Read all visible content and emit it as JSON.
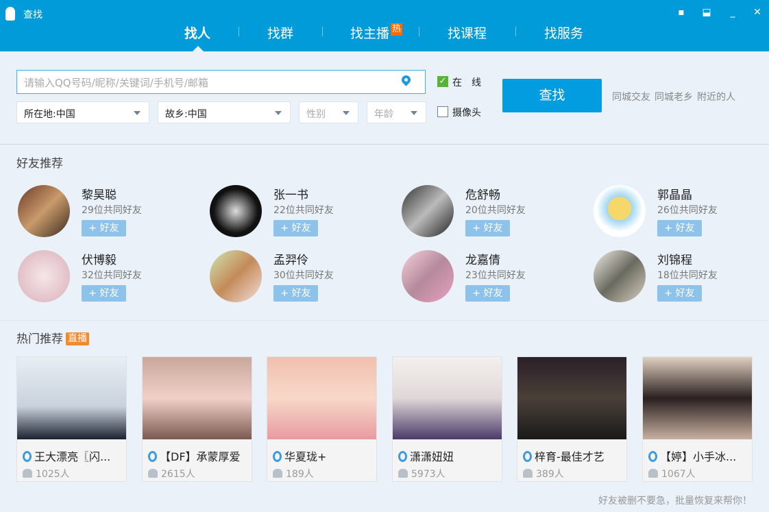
{
  "window": {
    "title": "查找",
    "controls": [
      "feedback-icon",
      "skin-icon",
      "minimize-icon",
      "close-icon"
    ]
  },
  "tabs": [
    {
      "label": "找人",
      "active": true
    },
    {
      "label": "找群"
    },
    {
      "label": "找主播",
      "badge": "热"
    },
    {
      "label": "找课程"
    },
    {
      "label": "找服务"
    }
  ],
  "search": {
    "placeholder": "请输入QQ号码/昵称/关键词/手机号/邮箱",
    "value": "",
    "button": "查找"
  },
  "filters": {
    "location": "所在地:中国",
    "hometown": "故乡:中国",
    "gender": "性别",
    "age": "年龄"
  },
  "checks": {
    "online": {
      "label": "在　线",
      "checked": true
    },
    "camera": {
      "label": "摄像头",
      "checked": false
    }
  },
  "quick_links": [
    "同城交友",
    "同城老乡",
    "附近的人"
  ],
  "friends": {
    "title": "好友推荐",
    "add_label": "+ 好友",
    "items": [
      {
        "name": "黎昊聪",
        "mutual": "29位共同好友"
      },
      {
        "name": "张一书",
        "mutual": "22位共同好友"
      },
      {
        "name": "危舒畅",
        "mutual": "20位共同好友"
      },
      {
        "name": "郭晶晶",
        "mutual": "26位共同好友"
      },
      {
        "name": "伏博毅",
        "mutual": "32位共同好友"
      },
      {
        "name": "孟羿伶",
        "mutual": "30位共同好友"
      },
      {
        "name": "龙嘉倩",
        "mutual": "23位共同好友"
      },
      {
        "name": "刘锦程",
        "mutual": "18位共同好友"
      }
    ]
  },
  "hot": {
    "title": "热门推荐",
    "badge": "直播",
    "items": [
      {
        "name": "王大漂亮〖闪...",
        "count": "1025人"
      },
      {
        "name": "【DF】承蒙厚爱",
        "count": "2615人"
      },
      {
        "name": "华夏珑+",
        "count": "189人"
      },
      {
        "name": "潇潇妞妞",
        "count": "5973人"
      },
      {
        "name": "梓育-最佳才艺",
        "count": "389人"
      },
      {
        "name": "【婷】小手冰...",
        "count": "1067人"
      }
    ]
  },
  "footer": "好友被删不要急，批量恢复来帮你！",
  "colors": {
    "titlebar": "#029bd9",
    "accent": "#029ce0",
    "hot_badge": "#ff6a00",
    "live_badge": "#f08a2a"
  }
}
